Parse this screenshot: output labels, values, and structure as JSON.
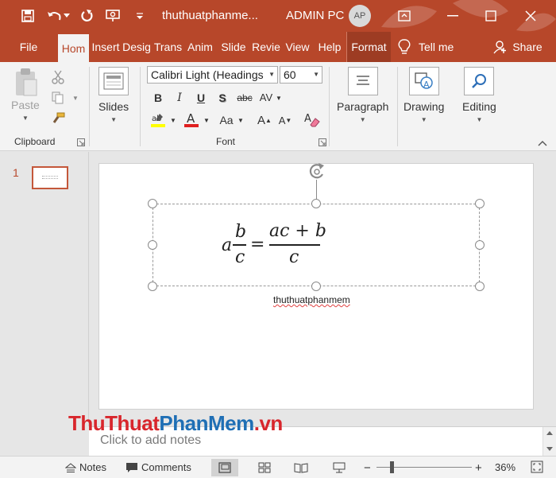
{
  "window": {
    "doc_title": "thuthuatphanme...",
    "user_name": "ADMIN PC",
    "avatar_initials": "AP",
    "accent_color": "#b7472a"
  },
  "tabs": [
    {
      "label": "File",
      "active": false
    },
    {
      "label": "Hom",
      "active": true
    },
    {
      "label": "Insert",
      "active": false
    },
    {
      "label": "Desig",
      "active": false
    },
    {
      "label": "Trans",
      "active": false
    },
    {
      "label": "Anim",
      "active": false
    },
    {
      "label": "Slide",
      "active": false
    },
    {
      "label": "Revie",
      "active": false
    },
    {
      "label": "View",
      "active": false
    },
    {
      "label": "Help",
      "active": false
    },
    {
      "label": "Format",
      "active": false
    }
  ],
  "tellme": "Tell me",
  "share": "Share",
  "ribbon": {
    "clipboard": {
      "paste": "Paste",
      "label": "Clipboard"
    },
    "slides": {
      "label": "Slides"
    },
    "font": {
      "family": "Calibri Light (Headings",
      "size": "60",
      "label": "Font",
      "buttons": [
        "B",
        "I",
        "U",
        "S",
        "abc",
        "AV",
        "Aa",
        "A",
        "A"
      ]
    },
    "paragraph": {
      "label": "Paragraph"
    },
    "drawing": {
      "label": "Drawing"
    },
    "editing": {
      "label": "Editing"
    }
  },
  "slides_pane": {
    "number": "1"
  },
  "equation": {
    "whole": "a",
    "num1": "b",
    "den1": "c",
    "equals": "=",
    "num2": "ac + b",
    "den2": "c"
  },
  "caption": "thuthuatphanmem",
  "notes_placeholder": "Click to add notes",
  "watermark": {
    "part1": "ThuThuat",
    "part2": "PhanMem",
    "part3": ".vn"
  },
  "status": {
    "notes": "Notes",
    "comments": "Comments",
    "zoom_minus": "−",
    "zoom_plus": "+",
    "zoom": "36%"
  }
}
